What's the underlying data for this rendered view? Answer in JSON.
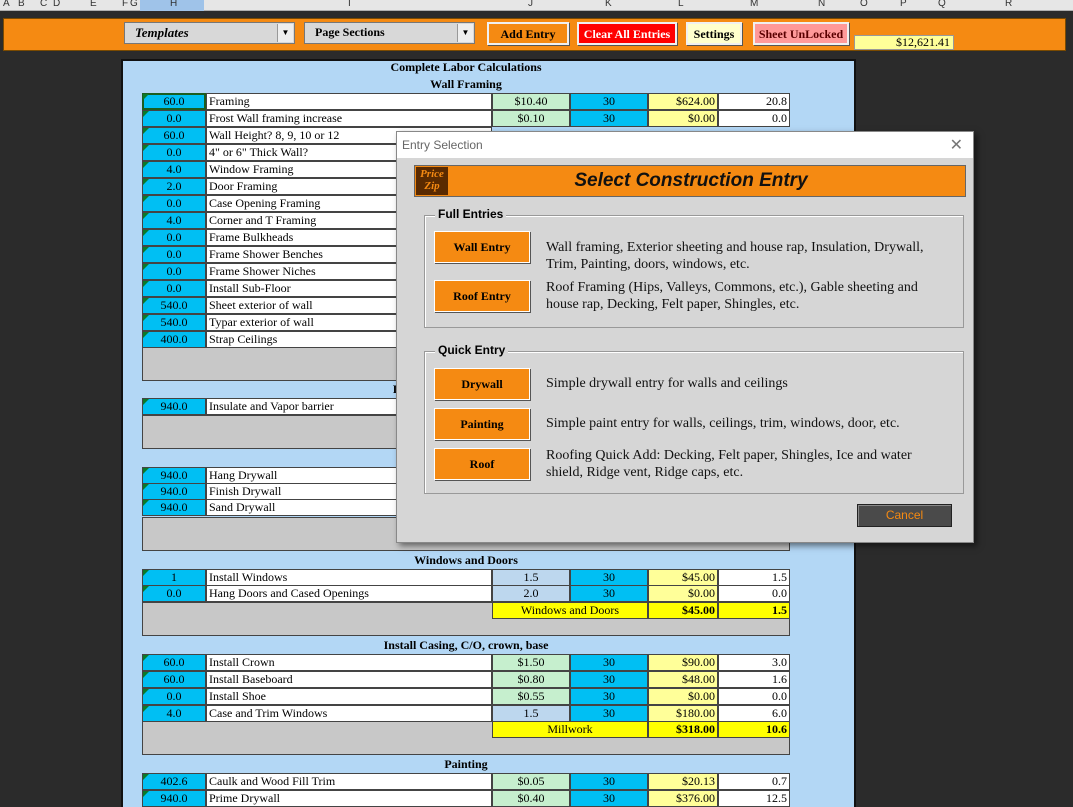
{
  "columns": [
    "A",
    "B",
    "C",
    "D",
    "E",
    "F",
    "G",
    "H",
    "I",
    "J",
    "K",
    "L",
    "M",
    "N",
    "O",
    "P",
    "Q",
    "R"
  ],
  "toolbar": {
    "templates_label": "Templates",
    "page_sections_label": "Page Sections",
    "add_entry": "Add Entry",
    "clear_all": "Clear All Entries",
    "settings": "Settings",
    "sheet_lock": "Sheet UnLocked",
    "total": "$12,621.41"
  },
  "sheet": {
    "title": "Complete Labor Calculations",
    "wall_framing": {
      "title": "Wall Framing",
      "rows": [
        {
          "qty": "60.0",
          "desc": "Framing",
          "rate": "$10.40",
          "pct": "30",
          "cost": "$624.00",
          "hrs": "20.8"
        },
        {
          "qty": "0.0",
          "desc": "Frost Wall framing increase",
          "rate": "$0.10",
          "pct": "30",
          "cost": "$0.00",
          "hrs": "0.0"
        },
        {
          "qty": "60.0",
          "desc": "Wall Height? 8, 9, 10 or 12"
        },
        {
          "qty": "0.0",
          "desc": "4\" or 6\" Thick Wall?"
        },
        {
          "qty": "4.0",
          "desc": "Window Framing"
        },
        {
          "qty": "2.0",
          "desc": "Door Framing"
        },
        {
          "qty": "0.0",
          "desc": "Case Opening Framing"
        },
        {
          "qty": "4.0",
          "desc": "Corner and T Framing"
        },
        {
          "qty": "0.0",
          "desc": "Frame Bulkheads"
        },
        {
          "qty": "0.0",
          "desc": "Frame Shower Benches"
        },
        {
          "qty": "0.0",
          "desc": "Frame Shower Niches"
        },
        {
          "qty": "0.0",
          "desc": "Install Sub-Floor"
        },
        {
          "qty": "540.0",
          "desc": "Sheet exterior of wall"
        },
        {
          "qty": "540.0",
          "desc": "Typar exterior of wall"
        },
        {
          "qty": "400.0",
          "desc": "Strap Ceilings"
        }
      ]
    },
    "insulation": {
      "title_fragment": "I",
      "rows": [
        {
          "qty": "940.0",
          "desc": "Insulate and Vapor barrier"
        }
      ]
    },
    "drywall": {
      "rows": [
        {
          "qty": "940.0",
          "desc": "Hang Drywall"
        },
        {
          "qty": "940.0",
          "desc": "Finish Drywall"
        },
        {
          "qty": "940.0",
          "desc": "Sand Drywall"
        }
      ]
    },
    "windows_doors": {
      "title": "Windows and Doors",
      "rows": [
        {
          "qty": "1",
          "desc": "Install Windows",
          "rate": "1.5",
          "pct": "30",
          "cost": "$45.00",
          "hrs": "1.5"
        },
        {
          "qty": "0.0",
          "desc": "Hang Doors and Cased Openings",
          "rate": "2.0",
          "pct": "30",
          "cost": "$0.00",
          "hrs": "0.0"
        }
      ],
      "sum_label": "Windows and Doors",
      "sum_cost": "$45.00",
      "sum_hrs": "1.5"
    },
    "casing": {
      "title": "Install Casing, C/O, crown, base",
      "rows": [
        {
          "qty": "60.0",
          "desc": "Install Crown",
          "rate": "$1.50",
          "pct": "30",
          "cost": "$90.00",
          "hrs": "3.0"
        },
        {
          "qty": "60.0",
          "desc": "Install Baseboard",
          "rate": "$0.80",
          "pct": "30",
          "cost": "$48.00",
          "hrs": "1.6"
        },
        {
          "qty": "0.0",
          "desc": "Install Shoe",
          "rate": "$0.55",
          "pct": "30",
          "cost": "$0.00",
          "hrs": "0.0"
        },
        {
          "qty": "4.0",
          "desc": "Case and Trim Windows",
          "rate": "1.5",
          "pct": "30",
          "cost": "$180.00",
          "hrs": "6.0"
        }
      ],
      "sum_label": "Millwork",
      "sum_cost": "$318.00",
      "sum_hrs": "10.6"
    },
    "painting": {
      "title": "Painting",
      "rows": [
        {
          "qty": "402.6",
          "desc": "Caulk and Wood Fill Trim",
          "rate": "$0.05",
          "pct": "30",
          "cost": "$20.13",
          "hrs": "0.7"
        },
        {
          "qty": "940.0",
          "desc": "Prime Drywall",
          "rate": "$0.40",
          "pct": "30",
          "cost": "$376.00",
          "hrs": "12.5"
        }
      ]
    }
  },
  "dialog": {
    "window_title": "Entry Selection",
    "close": "✕",
    "logo_top": "Price",
    "logo_bottom": "Zip",
    "heading": "Select Construction Entry",
    "full_entries_title": "Full Entries",
    "wall_entry": "Wall Entry",
    "wall_desc": "Wall framing, Exterior sheeting and house rap, Insulation, Drywall, Trim, Painting, doors, windows, etc.",
    "roof_entry": "Roof Entry",
    "roof_desc": "Roof Framing (Hips, Valleys, Commons, etc.), Gable sheeting and house rap, Decking, Felt paper, Shingles, etc.",
    "quick_entry_title": "Quick Entry",
    "drywall": "Drywall",
    "drywall_desc": "Simple drywall entry for walls and ceilings",
    "painting": "Painting",
    "painting_desc": "Simple paint entry for walls, ceilings, trim, windows, door, etc.",
    "roof": "Roof",
    "roof_quick_desc": "Roofing Quick Add:  Decking, Felt paper, Shingles, Ice and water shield, Ridge vent, Ridge caps, etc.",
    "cancel": "Cancel"
  },
  "colors": {
    "accent_orange": "#f58a12",
    "cyan": "#00bff3",
    "yellow": "#ffff99",
    "green": "#c6efce",
    "clear_red": "#ff0000"
  }
}
